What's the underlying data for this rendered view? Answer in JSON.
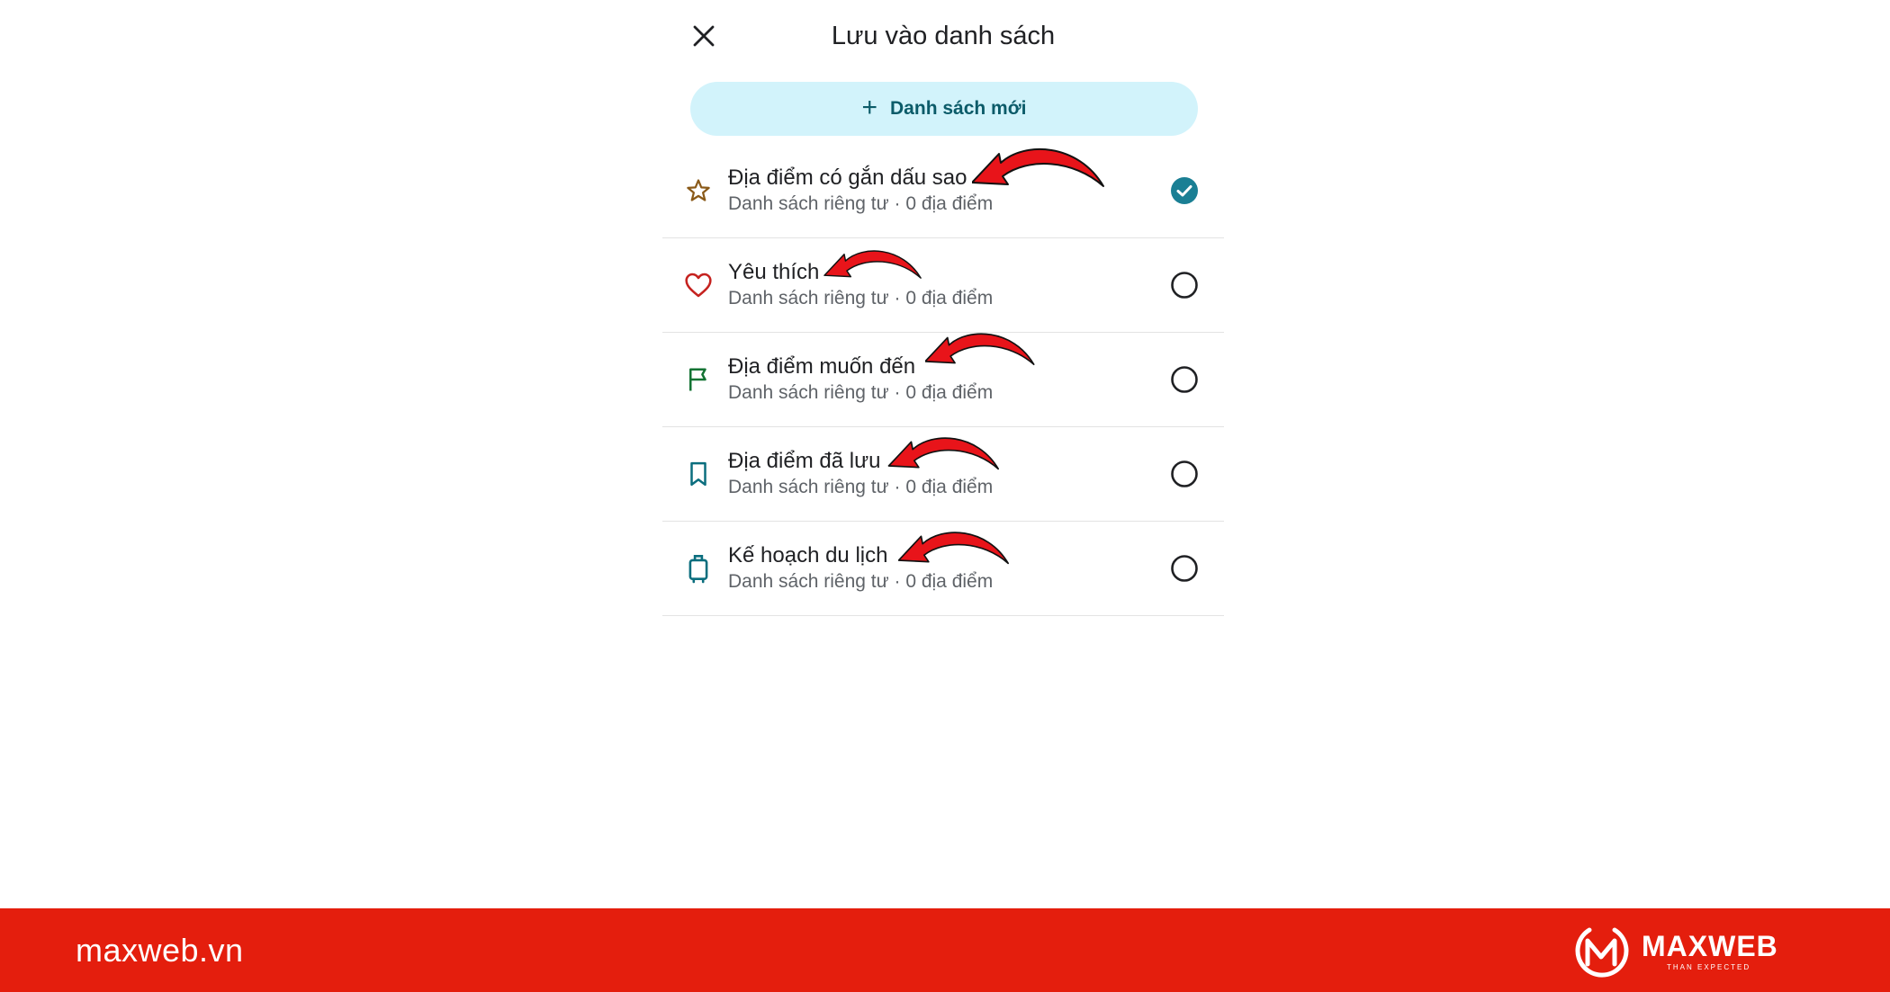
{
  "header": {
    "title": "Lưu vào danh sách"
  },
  "new_list": {
    "label": "Danh sách mới"
  },
  "lists": [
    {
      "name": "Địa điểm có gắn dấu sao",
      "meta": "Danh sách riêng tư · 0 địa điểm",
      "icon": "star-icon",
      "icon_color": "#8a5a19",
      "checked": true
    },
    {
      "name": "Yêu thích",
      "meta": "Danh sách riêng tư · 0 địa điểm",
      "icon": "heart-icon",
      "icon_color": "#c5221f",
      "checked": false
    },
    {
      "name": "Địa điểm muốn đến",
      "meta": "Danh sách riêng tư · 0 địa điểm",
      "icon": "flag-icon",
      "icon_color": "#137333",
      "checked": false
    },
    {
      "name": "Địa điểm đã lưu",
      "meta": "Danh sách riêng tư · 0 địa điểm",
      "icon": "bookmark-icon",
      "icon_color": "#0b6e7e",
      "checked": false
    },
    {
      "name": "Kế hoạch du lịch",
      "meta": "Danh sách riêng tư · 0 địa điểm",
      "icon": "suitcase-icon",
      "icon_color": "#0b6e7e",
      "checked": false
    }
  ],
  "colors": {
    "accent": "#1a7f94",
    "footer": "#e41e0d",
    "annotation_arrow": "#e8141a"
  },
  "footer": {
    "site": "maxweb.vn",
    "brand": "MAXWEB",
    "tagline": "THAN EXPECTED"
  }
}
